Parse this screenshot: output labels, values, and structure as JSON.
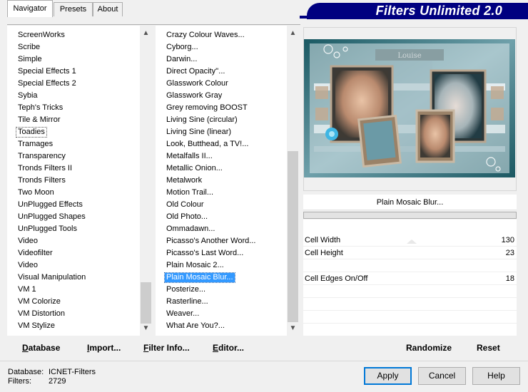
{
  "tabs": [
    "Navigator",
    "Presets",
    "About"
  ],
  "banner_title": "Filters Unlimited 2.0",
  "categories": [
    "ScreenWorks",
    "Scribe",
    "Simple",
    "Special Effects 1",
    "Special Effects 2",
    "Sybia",
    "Teph's Tricks",
    "Tile & Mirror",
    "Toadies",
    "Tramages",
    "Transparency",
    "Tronds Filters II",
    "Tronds Filters",
    "Two Moon",
    "UnPlugged Effects",
    "UnPlugged Shapes",
    "UnPlugged Tools",
    "Video",
    "Videofilter",
    "Video",
    "Visual Manipulation",
    "VM 1",
    "VM Colorize",
    "VM Distortion",
    "VM Stylize"
  ],
  "focused_category": "Toadies",
  "filters": [
    "Crazy Colour Waves...",
    "Cyborg...",
    "Darwin...",
    "Direct Opacity''...",
    "Glasswork Colour",
    "Glasswork Gray",
    "Grey removing BOOST",
    "Living Sine (circular)",
    "Living Sine (linear)",
    "Look, Butthead, a TV!...",
    "Metalfalls II...",
    "Metallic Onion...",
    "Metalwork",
    "Motion Trail...",
    "Old Colour",
    "Old Photo...",
    "Ommadawn...",
    "Picasso's Another Word...",
    "Picasso's Last Word...",
    "Plain Mosaic 2...",
    "Plain Mosaic Blur...",
    "Posterize...",
    "Rasterline...",
    "Weaver...",
    "What Are You?..."
  ],
  "selected_filter": "Plain Mosaic Blur...",
  "preview_watermark": "Louise",
  "filter_title": "Plain Mosaic Blur...",
  "params": [
    {
      "label": "Cell Width",
      "value": "130"
    },
    {
      "label": "Cell Height",
      "value": "23"
    },
    {
      "label": "Cell Edges On/Off",
      "value": "18"
    }
  ],
  "buttons": {
    "database": "Database",
    "import": "Import...",
    "filter_info": "Filter Info...",
    "editor": "Editor...",
    "randomize": "Randomize",
    "reset": "Reset",
    "apply": "Apply",
    "cancel": "Cancel",
    "help": "Help"
  },
  "status": {
    "database_label": "Database:",
    "database_value": "ICNET-Filters",
    "filters_label": "Filters:",
    "filters_value": "2729"
  },
  "colors": {
    "banner": "#000080",
    "selection": "#3399ff",
    "preview_teal": "#1d5c67"
  }
}
